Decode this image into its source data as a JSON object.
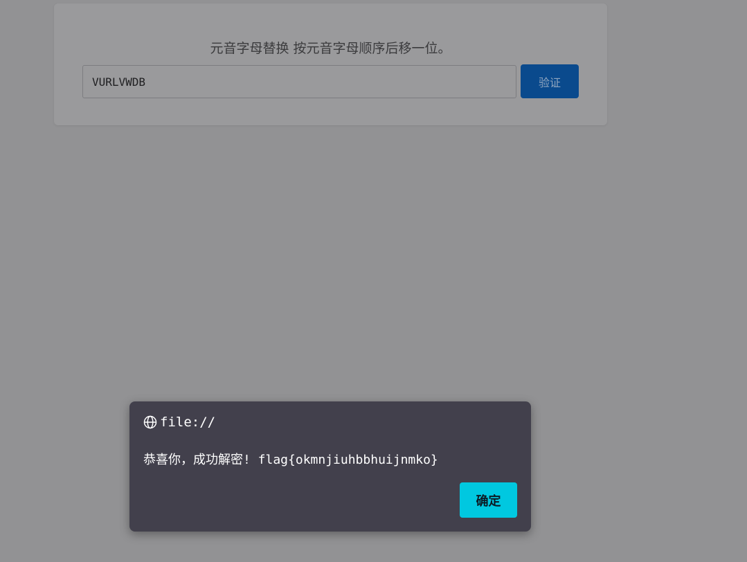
{
  "form": {
    "title": "元音字母替换 按元音字母顺序后移一位。",
    "input_value": "VURLVWDB",
    "verify_label": "验证",
    "button_color": "#0a4a8d"
  },
  "dialog": {
    "origin": "file://",
    "message": "恭喜你，成功解密! flag{okmnjiuhbbhuijnmko}",
    "ok_label": "确定",
    "icon": "globe-icon",
    "button_color": "#00c8e0"
  }
}
